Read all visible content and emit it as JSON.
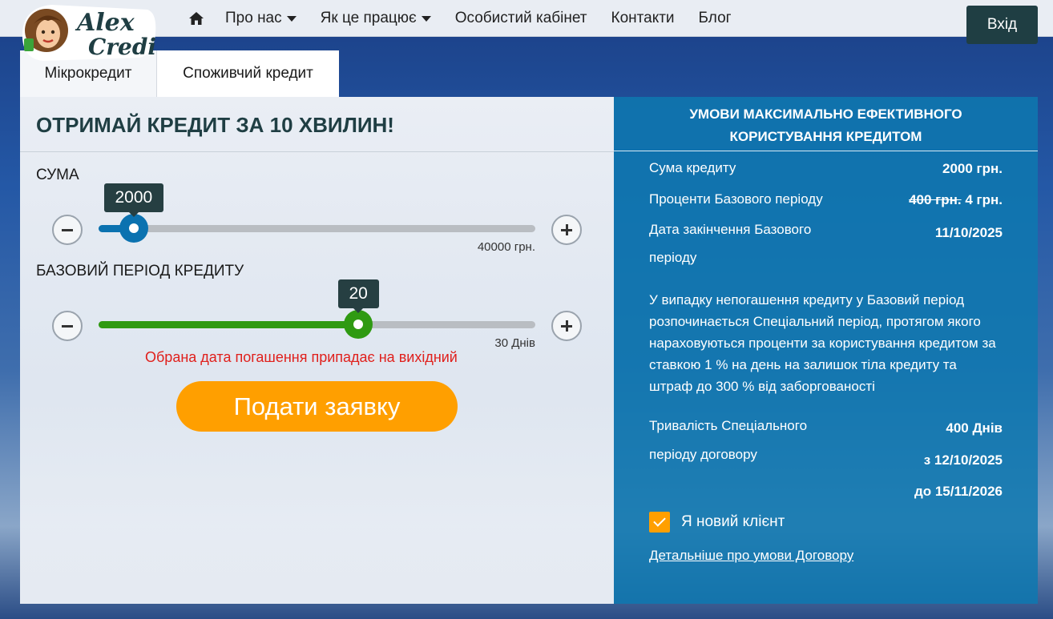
{
  "header": {
    "logo_text_1": "Alex",
    "logo_text_2": "Credit",
    "home_icon": "home-icon",
    "nav": [
      {
        "label": "Про нас",
        "dropdown": true
      },
      {
        "label": "Як це працює",
        "dropdown": true
      },
      {
        "label": "Особистий кабінет",
        "dropdown": false
      },
      {
        "label": "Контакти",
        "dropdown": false
      },
      {
        "label": "Блог",
        "dropdown": false
      }
    ],
    "login_label": "Вхід"
  },
  "tabs": [
    {
      "label": "Мікрокредит",
      "active": false
    },
    {
      "label": "Споживчий кредит",
      "active": true
    }
  ],
  "calculator": {
    "title": "ОТРИМАЙ КРЕДИТ ЗА 10 ХВИЛИН!",
    "amount": {
      "label": "СУМА",
      "value": "2000",
      "position_fraction": 0.08,
      "max_label": "40000 грн.",
      "color": "#0b72b0"
    },
    "period": {
      "label": "БАЗОВИЙ ПЕРІОД КРЕДИТУ",
      "value": "20",
      "position_fraction": 0.595,
      "max_label": "30 Днів",
      "color": "#2f9a12"
    },
    "warning": "Обрана дата погашення припадає на вихідний",
    "submit_label": "Подати заявку"
  },
  "conditions": {
    "title_line1": "УМОВИ МАКСИМАЛЬНО ЕФЕКТИВНОГО",
    "title_line2": "КОРИСТУВАННЯ КРЕДИТОМ",
    "amount_label": "Сума кредиту",
    "amount_value": "2000 грн.",
    "interest_label": "Проценти Базового періоду",
    "interest_old": "400 грн.",
    "interest_new": "4 грн.",
    "end_date_label_1": "Дата закінчення Базового",
    "end_date_label_2": "періоду",
    "end_date_value": "11/10/2025",
    "special_text": "У випадку непогашення кредиту у Базовий період розпочинається Спеціальний період, протягом якого нараховуються проценти за користування кредитом за ставкою 1 % на день на залишок тіла кредиту та штраф до 300 % від заборгованості",
    "duration_label_1": "Тривалість Спеціального",
    "duration_label_2": "періоду договору",
    "duration_value": "400 Днів",
    "duration_from": "з 12/10/2025",
    "duration_to": "до 15/11/2026",
    "new_client_label": "Я новий клієнт",
    "new_client_checked": true,
    "details_link": "Детальніше про умови Договору"
  }
}
